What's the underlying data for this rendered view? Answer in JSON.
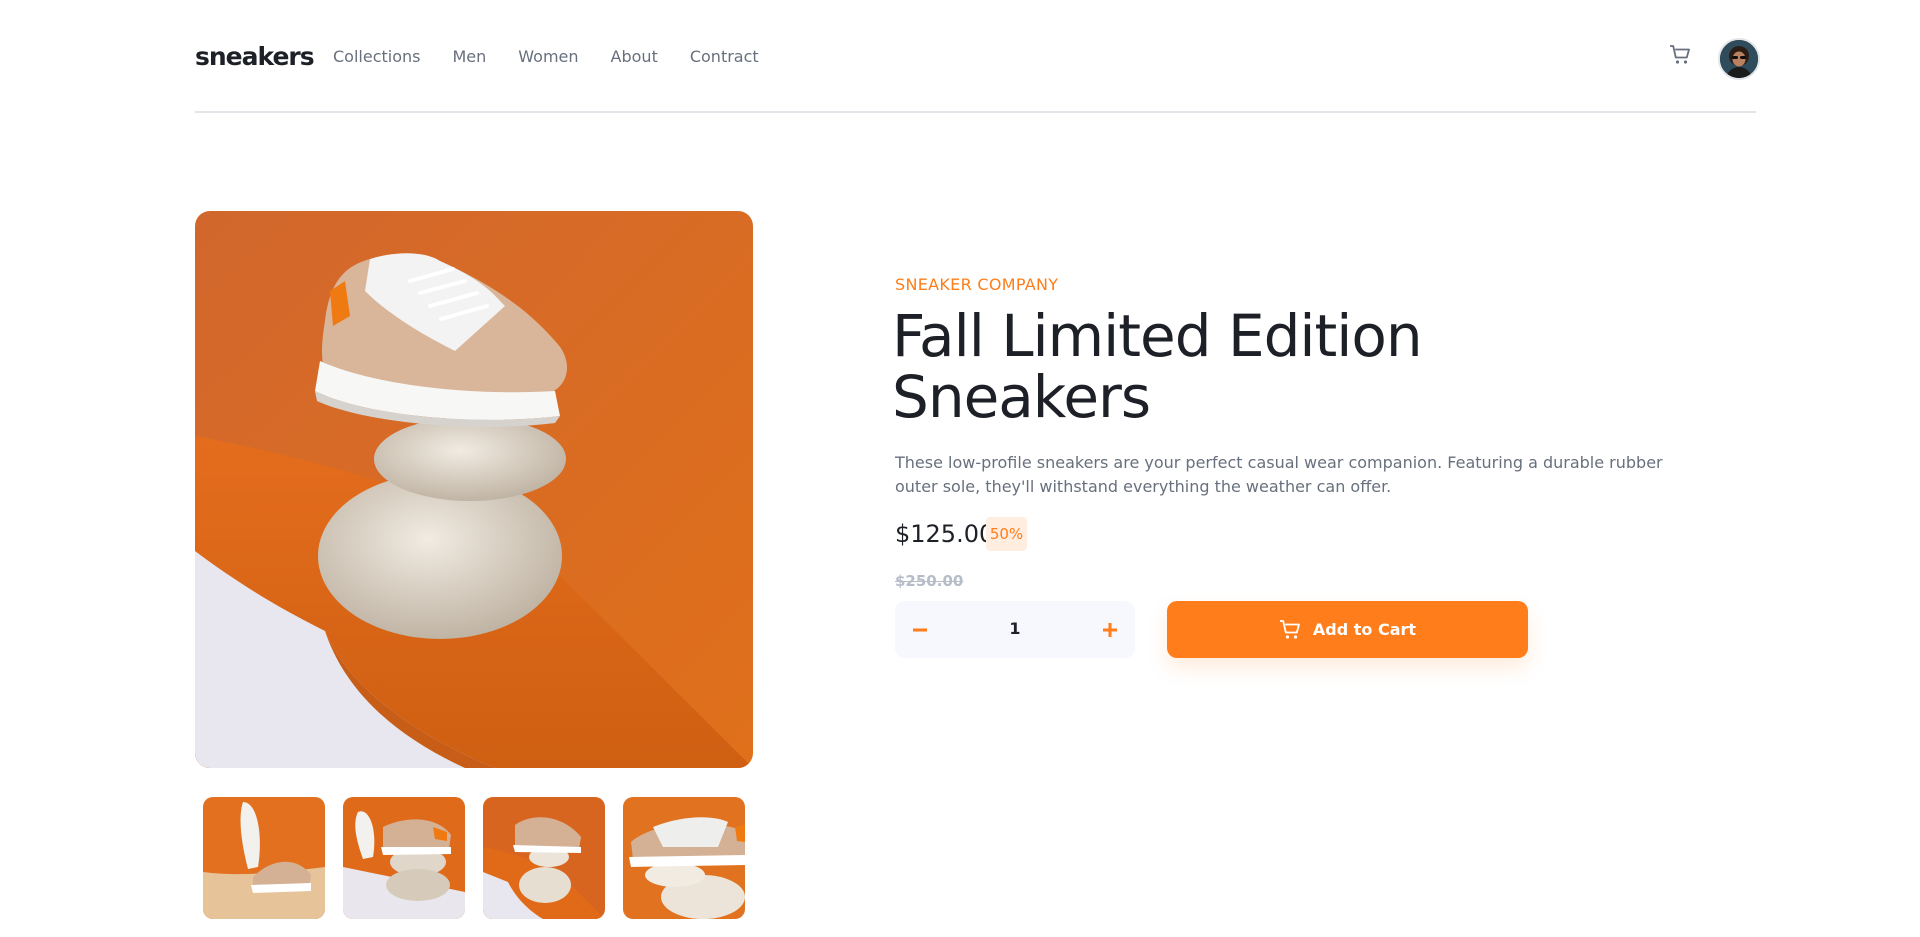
{
  "header": {
    "logo": "sneakers",
    "nav": [
      "Collections",
      "Men",
      "Women",
      "About",
      "Contract"
    ],
    "cart_icon": "cart-icon",
    "avatar_icon": "avatar"
  },
  "product": {
    "company": "SNEAKER COMPANY",
    "title": "Fall Limited Edition Sneakers",
    "description": "These low-profile sneakers are your perfect casual wear companion. Featuring a durable rubber outer sole, they'll withstand everything the weather can offer.",
    "price": "$125.00",
    "discount": "50%",
    "original_price": "$250.00",
    "quantity": "1",
    "add_to_cart": "Add to Cart"
  },
  "colors": {
    "accent": "#ff7d1a",
    "accent_pale": "#ffede0",
    "dark": "#1d2026",
    "grey": "#68707d",
    "light_grey": "#b6bcc8"
  }
}
